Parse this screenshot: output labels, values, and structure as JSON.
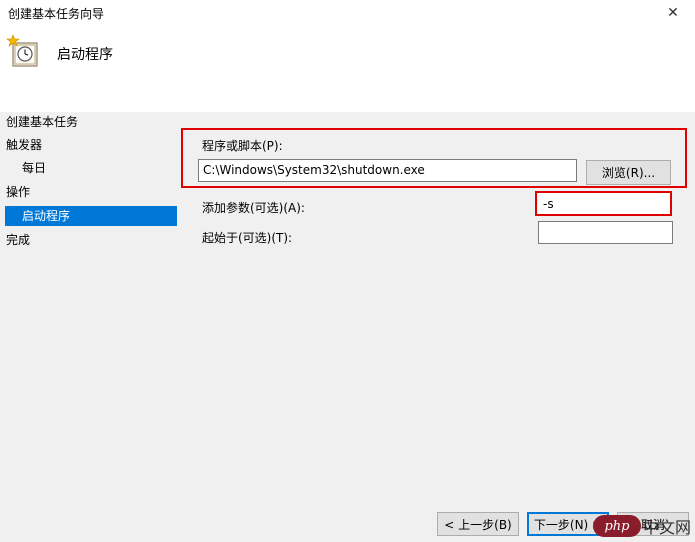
{
  "window": {
    "title": "创建基本任务向导",
    "close_glyph": "✕"
  },
  "header": {
    "heading": "启动程序"
  },
  "sidebar": {
    "items": [
      {
        "label": "创建基本任务"
      },
      {
        "label": "触发器"
      },
      {
        "label": "每日"
      },
      {
        "label": "操作"
      },
      {
        "label": "启动程序"
      },
      {
        "label": "完成"
      }
    ]
  },
  "form": {
    "program_label": "程序或脚本(P):",
    "program_value": "C:\\Windows\\System32\\shutdown.exe",
    "browse_label": "浏览(R)...",
    "args_label": "添加参数(可选)(A):",
    "args_value": "-s",
    "startin_label": "起始于(可选)(T):",
    "startin_value": ""
  },
  "footer": {
    "back_label": "< 上一步(B)",
    "next_label": "下一步(N) >",
    "cancel_label": "取消"
  },
  "watermark": {
    "badge": "php",
    "text": "中文网"
  },
  "colors": {
    "accent": "#0078d7",
    "highlight_border": "#e00000"
  }
}
